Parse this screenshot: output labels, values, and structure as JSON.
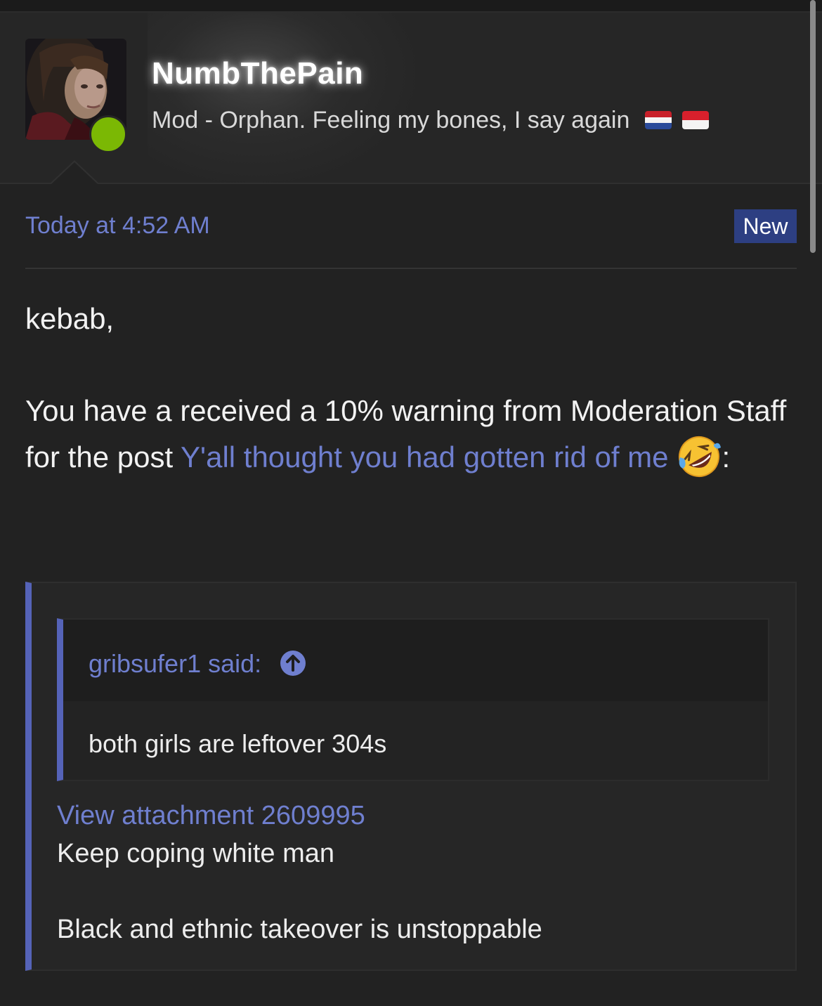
{
  "profile": {
    "username": "NumbThePain",
    "title": "Mod - Orphan. Feeling my bones, I say again",
    "avatar_icon": "user-avatar-icon",
    "online_status": "online",
    "online_color": "#7bb804",
    "flags": [
      "netherlands-flag-icon",
      "indonesia-flag-icon"
    ]
  },
  "post": {
    "timestamp": "Today at 4:52 AM",
    "badge": "New",
    "greeting": "kebab,",
    "warning_prefix": "You have a received a 10% warning from Moderation Staff for the post ",
    "post_link": "Y'all thought you had gotten rid of me",
    "emoji_icon": "rolling-on-floor-laughing-emoji",
    "warning_suffix": ":",
    "quote": {
      "nested_author": "gribsufer1 said:",
      "nested_icon": "arrow-up-circle-icon",
      "nested_text": "both girls are leftover 304s",
      "attachment_link": "View attachment 2609995",
      "line1": "Keep coping white man",
      "line2": "Black and ethnic takeover is unstoppable"
    }
  },
  "colors": {
    "background": "#222222",
    "link": "#6f7fcf",
    "quote_border": "#5563b8",
    "badge_bg": "#2d3f82"
  }
}
